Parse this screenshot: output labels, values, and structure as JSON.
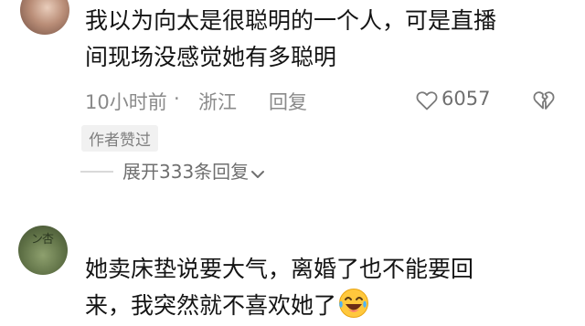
{
  "comment_1": {
    "text_line_1": "我以为向太是很聪明的一个人，可是直播",
    "text_line_2": "间现场没感觉她有多聪明",
    "time": "10小时前",
    "separator": "·",
    "location": "浙江",
    "reply_label": "回复",
    "like_count": "6057",
    "author_badge": "作者赞过",
    "expand_replies_label": "展开333条回复"
  },
  "comment_2": {
    "avatar_name_fragment": "ン杏",
    "text_line_1": "她卖床垫说要大气，离婚了也不能要回",
    "text_line_2": "来，我突然就不喜欢她了"
  },
  "icons": {
    "like": "heart-outline-icon",
    "dislike": "broken-heart-icon",
    "chevron": "chevron-down-icon",
    "emoji": "laughing-tears-emoji-icon"
  },
  "colors": {
    "text_primary": "#141414",
    "text_secondary": "#8a8a8a",
    "badge_bg": "#f1f1f1"
  }
}
